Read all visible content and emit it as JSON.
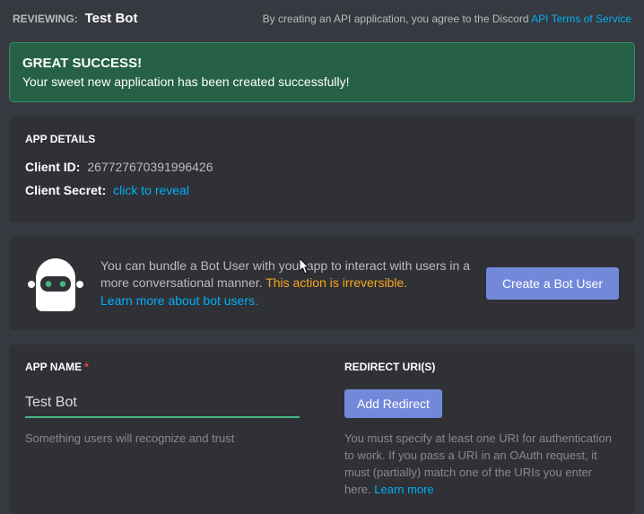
{
  "header": {
    "reviewing_label": "Reviewing:",
    "app_name": "Test Bot",
    "tos_text": "By creating an API application, you agree to the Discord ",
    "tos_link": "API Terms of Service"
  },
  "success": {
    "title": "Great Success!",
    "message": "Your sweet new application has been created successfully!"
  },
  "details": {
    "heading": "App Details",
    "client_id_label": "Client ID:",
    "client_id_value": "267727670391996426",
    "client_secret_label": "Client Secret:",
    "reveal_text": "click to reveal"
  },
  "bot": {
    "text1": "You can bundle a Bot User with your app to interact with users in a more conversational manner. ",
    "irreversible": "This action is irreversible.",
    "learn_more": "Learn more about bot users.",
    "create_button": "Create a Bot User"
  },
  "form": {
    "app_name_label": "App Name",
    "app_name_value": "Test Bot",
    "app_name_helper": "Something users will recognize and trust",
    "redirect_label": "Redirect URI(s)",
    "add_redirect_button": "Add Redirect",
    "redirect_helper_1": "You must specify at least one URI for authentication to work. If you pass a URI in an OAuth request, it must (partially) match one of the URIs you enter here. ",
    "redirect_learn_more": "Learn more"
  }
}
